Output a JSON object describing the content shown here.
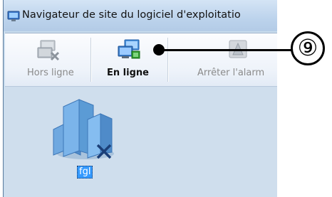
{
  "window": {
    "title": "Navigateur de site du logiciel d'exploitatio",
    "title_icon": "window-app-icon"
  },
  "toolbar": {
    "buttons": [
      {
        "label": "Hors ligne",
        "icon": "offline-icon",
        "enabled": false
      },
      {
        "label": "En ligne",
        "icon": "online-icon",
        "enabled": true
      },
      {
        "label": "Arrêter l'alarm",
        "icon": "stop-alarm-icon",
        "enabled": false
      }
    ]
  },
  "site": {
    "label": "fgl",
    "icon": "site-buildings-icon",
    "selected": true
  },
  "callout": {
    "number": "⑨"
  },
  "colors": {
    "title_gradient_top": "#d4e4f5",
    "toolbar_bg": "#eef3fa",
    "content_bg": "#cfdeed",
    "selection": "#3399ff",
    "disabled_text": "#8a8a8a",
    "online_green": "#2e9a2e",
    "building_blue": "#5b9bd5"
  }
}
